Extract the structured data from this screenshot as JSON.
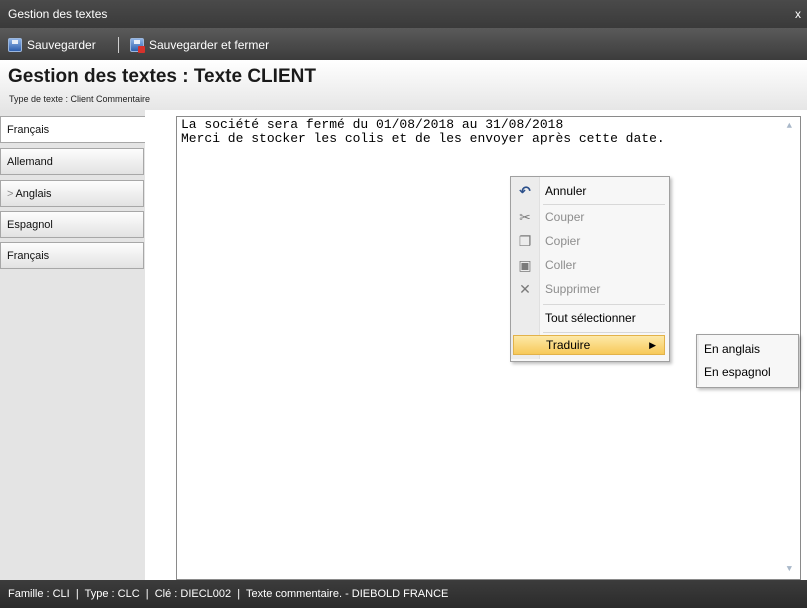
{
  "window": {
    "title": "Gestion des textes",
    "close_glyph": "x"
  },
  "toolbar": {
    "save_label": "Sauvegarder",
    "save_close_label": "Sauvegarder et fermer",
    "save_icon": "floppy-disk-icon",
    "save_close_icon": "floppy-disk-close-icon"
  },
  "header": {
    "title": "Gestion des textes : Texte CLIENT",
    "subtitle": "Type de texte : Client Commentaire"
  },
  "languages": [
    {
      "label": "Français",
      "active": true
    },
    {
      "label": "Allemand",
      "active": false
    },
    {
      "label": "Anglais",
      "active": false,
      "chevron": ">"
    },
    {
      "label": "Espagnol",
      "active": false
    },
    {
      "label": "Français",
      "active": false
    }
  ],
  "editor": {
    "lines": [
      "La société sera fermé du 01/08/2018 au 31/08/2018",
      "Merci de stocker les colis et de les envoyer après cette date."
    ]
  },
  "context_menu": {
    "items": [
      {
        "label": "Annuler",
        "icon": "undo-icon",
        "enabled": true
      },
      {
        "label": "Couper",
        "icon": "scissors-icon",
        "enabled": false
      },
      {
        "label": "Copier",
        "icon": "copy-icon",
        "enabled": false
      },
      {
        "label": "Coller",
        "icon": "paste-icon",
        "enabled": false
      },
      {
        "label": "Supprimer",
        "icon": "delete-icon",
        "enabled": false
      },
      {
        "label": "Tout sélectionner",
        "icon": "",
        "enabled": true
      },
      {
        "label": "Traduire",
        "icon": "",
        "enabled": true,
        "submenu": true
      }
    ],
    "submenu": [
      "En anglais",
      "En espagnol"
    ]
  },
  "statusbar": {
    "text": "Famille : CLI  |  Type : CLC  |  Clé : DIECL002  |  Texte commentaire. - DIEBOLD FRANCE"
  },
  "colors": {
    "highlight": "#f7c95a",
    "dark_bar": "#3c3c3c",
    "accent_icon": "#2f5fae"
  }
}
